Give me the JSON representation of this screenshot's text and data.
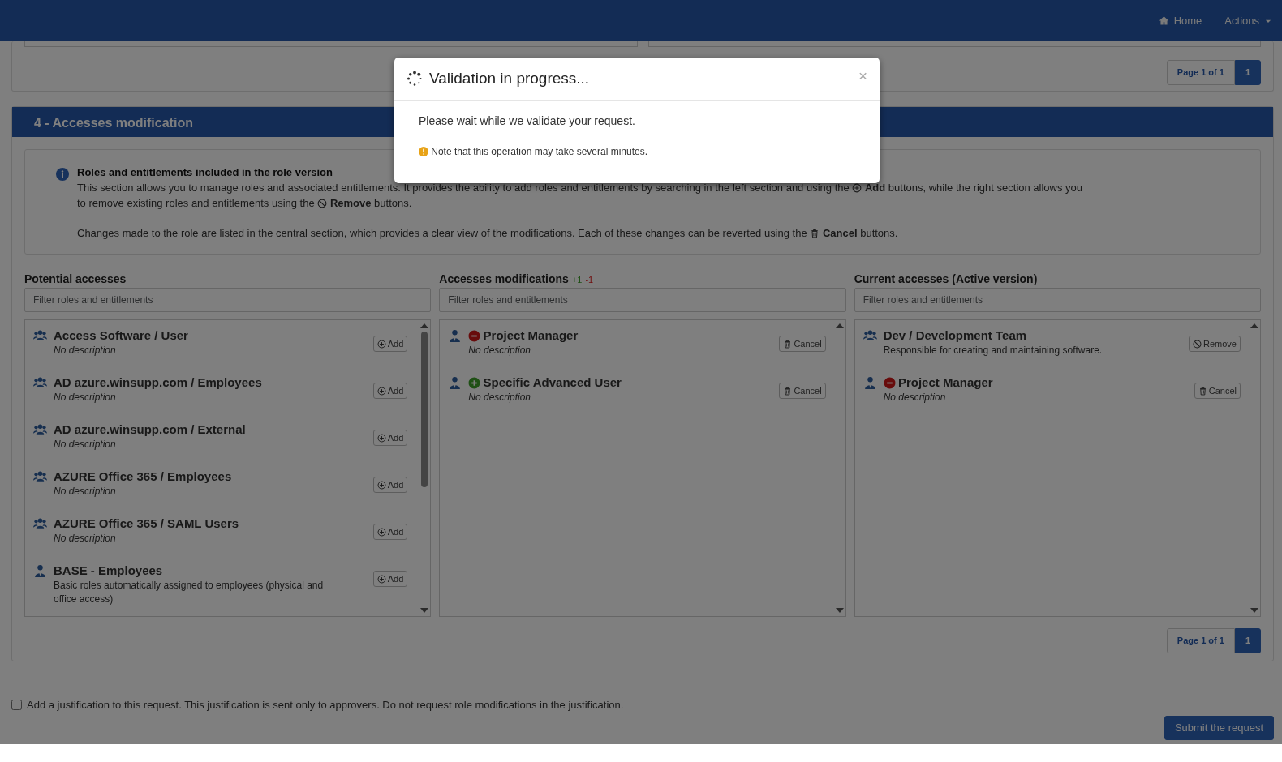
{
  "navbar": {
    "links": [
      {
        "kind": "home",
        "label": "Home"
      },
      {
        "kind": "dropdown",
        "label": "Actions"
      }
    ]
  },
  "previous_section": {
    "pagination": {
      "summary": "Page 1 of 1",
      "pages": [
        {
          "label": "1",
          "selected": true
        }
      ]
    }
  },
  "section": {
    "title": "4 - Accesses modification",
    "info": {
      "title": "Roles and entitlements included in the role version",
      "paragraphs": [
        [
          {
            "kind": "text",
            "text": "This section allows you to manage roles and associated entitlements. It provides the ability to add roles and entitlements by searching in the left section and using the"
          },
          {
            "kind": "add"
          },
          {
            "kind": "text",
            "text": "**Add** buttons, while the right section allows you to remove existing roles and entitlements using the"
          },
          {
            "kind": "remove"
          },
          {
            "kind": "text",
            "text": "**Remove** buttons."
          }
        ],
        [
          {
            "kind": "text",
            "text": "Changes made to the role are listed in the central section, which provides a clear view of the modifications. Each of these changes can be reverted using the"
          },
          {
            "kind": "cancel"
          },
          {
            "kind": "text",
            "text": "**Cancel** buttons."
          }
        ]
      ]
    },
    "columns": [
      {
        "title": "Potential accesses",
        "filter_placeholder": "Filter roles and entitlements",
        "scroll_thumb": true,
        "items": [
          {
            "kind": "group",
            "name": "Access Software / User",
            "description": "No description",
            "no_description": true,
            "action": {
              "kind": "add",
              "label": "Add"
            }
          },
          {
            "kind": "group",
            "name": "AD azure.winsupp.com / Employees",
            "description": "No description",
            "no_description": true,
            "action": {
              "kind": "add",
              "label": "Add"
            }
          },
          {
            "kind": "group",
            "name": "AD azure.winsupp.com / External",
            "description": "No description",
            "no_description": true,
            "action": {
              "kind": "add",
              "label": "Add"
            }
          },
          {
            "kind": "group",
            "name": "AZURE Office 365 / Employees",
            "description": "No description",
            "no_description": true,
            "action": {
              "kind": "add",
              "label": "Add"
            }
          },
          {
            "kind": "group",
            "name": "AZURE Office 365 / SAML Users",
            "description": "No description",
            "no_description": true,
            "action": {
              "kind": "add",
              "label": "Add"
            }
          },
          {
            "kind": "user",
            "name": "BASE - Employees",
            "description": "Basic roles automatically assigned to employees (physical and office access)",
            "no_description": false,
            "action": {
              "kind": "add",
              "label": "Add"
            }
          }
        ]
      },
      {
        "title": "Accesses modifications",
        "counts": [
          {
            "text": "+1",
            "kind": "added"
          },
          {
            "text": "-1",
            "kind": "removed"
          }
        ],
        "filter_placeholder": "Filter roles and entitlements",
        "scroll_thumb": false,
        "items": [
          {
            "kind": "user",
            "added": false,
            "removed": true,
            "name": "Project Manager",
            "description": "No description",
            "no_description": true,
            "action": {
              "kind": "cancel",
              "label": "Cancel"
            }
          },
          {
            "kind": "user",
            "added": true,
            "removed": false,
            "name": "Specific Advanced User",
            "description": "No description",
            "no_description": true,
            "action": {
              "kind": "cancel",
              "label": "Cancel"
            }
          }
        ]
      },
      {
        "title": "Current accesses (Active version)",
        "filter_placeholder": "Filter roles and entitlements",
        "scroll_thumb": false,
        "items": [
          {
            "kind": "group",
            "added": false,
            "removed": false,
            "struck": false,
            "name": "Dev / Development Team",
            "description": "Responsible for creating and maintaining software.",
            "no_description": false,
            "action": {
              "kind": "remove",
              "label": "Remove"
            }
          },
          {
            "kind": "user",
            "added": false,
            "removed": true,
            "struck": true,
            "name": "Project Manager",
            "description": "No description",
            "no_description": true,
            "action": {
              "kind": "cancel",
              "label": "Cancel"
            }
          }
        ]
      }
    ],
    "pagination": {
      "summary": "Page 1 of 1",
      "pages": [
        {
          "label": "1",
          "selected": true
        }
      ]
    }
  },
  "justification": {
    "label": "Add a justification to this request. This justification is sent only to approvers. Do not request role modifications in the justification.",
    "checked": false
  },
  "submit_button": {
    "label": "Submit the request"
  },
  "modal": {
    "title": "Validation in progress...",
    "close": "×",
    "message": "Please wait while we validate your request.",
    "note": "Note that this operation may take several minutes."
  }
}
